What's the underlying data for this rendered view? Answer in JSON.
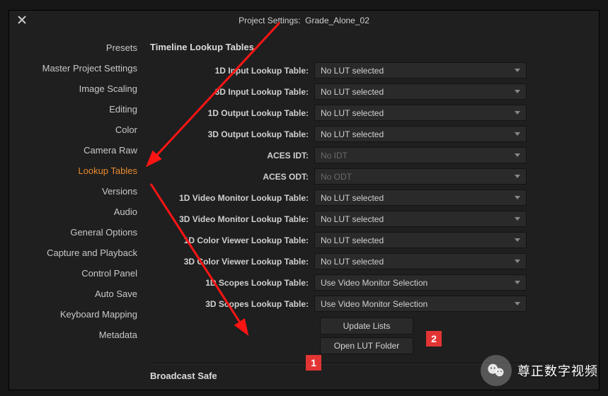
{
  "title_prefix": "Project Settings:",
  "project_name": "Grade_Alone_02",
  "sidebar": {
    "items": [
      {
        "label": "Presets"
      },
      {
        "label": "Master Project Settings"
      },
      {
        "label": "Image Scaling"
      },
      {
        "label": "Editing"
      },
      {
        "label": "Color"
      },
      {
        "label": "Camera Raw"
      },
      {
        "label": "Lookup Tables",
        "active": true
      },
      {
        "label": "Versions"
      },
      {
        "label": "Audio"
      },
      {
        "label": "General Options"
      },
      {
        "label": "Capture and Playback"
      },
      {
        "label": "Control Panel"
      },
      {
        "label": "Auto Save"
      },
      {
        "label": "Keyboard Mapping"
      },
      {
        "label": "Metadata"
      }
    ]
  },
  "section1_title": "Timeline Lookup Tables",
  "rows": [
    {
      "label": "1D Input Lookup Table:",
      "value": "No LUT selected"
    },
    {
      "label": "3D Input Lookup Table:",
      "value": "No LUT selected"
    },
    {
      "label": "1D Output Lookup Table:",
      "value": "No LUT selected"
    },
    {
      "label": "3D Output Lookup Table:",
      "value": "No LUT selected"
    },
    {
      "label": "ACES IDT:",
      "value": "No IDT",
      "disabled": true
    },
    {
      "label": "ACES ODT:",
      "value": "No ODT",
      "disabled": true
    },
    {
      "label": "1D Video Monitor Lookup Table:",
      "value": "No LUT selected"
    },
    {
      "label": "3D Video Monitor Lookup Table:",
      "value": "No LUT selected"
    },
    {
      "label": "1D Color Viewer Lookup Table:",
      "value": "No LUT selected"
    },
    {
      "label": "3D Color Viewer Lookup Table:",
      "value": "No LUT selected"
    },
    {
      "label": "1D Scopes Lookup Table:",
      "value": "Use Video Monitor Selection"
    },
    {
      "label": "3D Scopes Lookup Table:",
      "value": "Use Video Monitor Selection"
    }
  ],
  "buttons": {
    "update": "Update Lists",
    "open_folder": "Open LUT Folder"
  },
  "section2_title": "Broadcast Safe",
  "annotations": {
    "badge1": "1",
    "badge2": "2"
  },
  "watermark": "尊正数字视频"
}
